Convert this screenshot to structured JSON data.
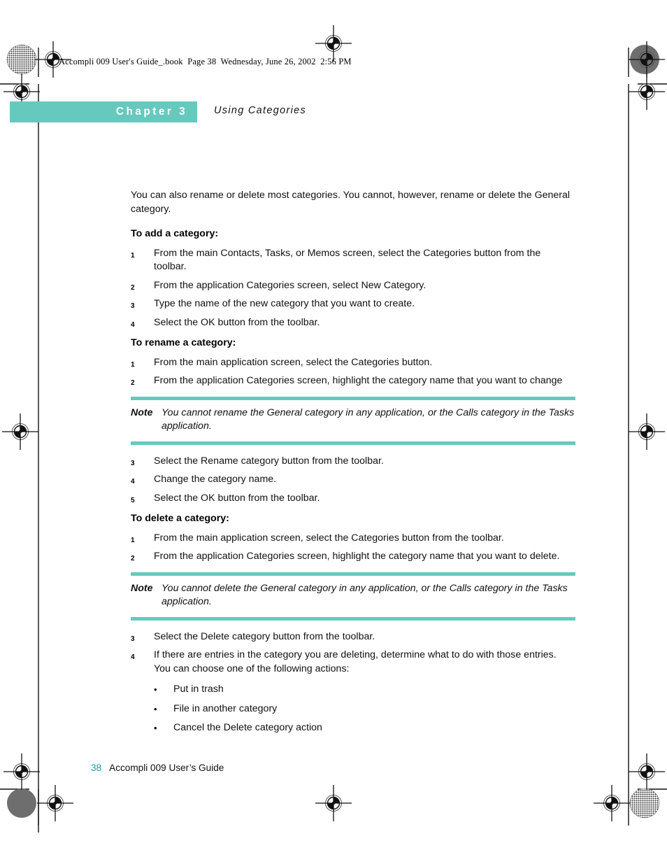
{
  "page": {
    "book_line": "Accompli 009 User's Guide_.book  Page 38  Wednesday, June 26, 2002  2:56 PM",
    "accent_color": "#66c9bd",
    "page_number_color": "#0aa79a"
  },
  "chapter": {
    "banner_label": "Chapter 3",
    "title": "Using Categories"
  },
  "content": {
    "intro_paragraph": "You can also rename or delete most categories. You cannot, however, rename or delete the General category.",
    "sections": [
      {
        "heading": "To add a category:",
        "steps": [
          {
            "num": "1",
            "text": "From the main Contacts, Tasks, or Memos screen, select the Categories button from the toolbar."
          },
          {
            "num": "2",
            "text": "From the application Categories screen, select New Category."
          },
          {
            "num": "3",
            "text": "Type the name of the new category that you want to create."
          },
          {
            "num": "4",
            "text": "Select the OK button from the toolbar."
          }
        ]
      },
      {
        "heading": "To rename a category:",
        "steps": [
          {
            "num": "1",
            "text": "From the main application screen, select the Categories button."
          },
          {
            "num": "2",
            "text": "From the application Categories screen, highlight the category name that you want to change"
          }
        ]
      }
    ],
    "note_rename": {
      "label": "Note",
      "text": "You cannot rename the General category in any application, or the Calls category in the Tasks application."
    },
    "rename_steps_after_note": [
      {
        "num": "3",
        "text": "Select the Rename category button from the toolbar."
      },
      {
        "num": "4",
        "text": "Change the category name."
      },
      {
        "num": "5",
        "text": "Select the OK button from the toolbar."
      }
    ],
    "delete_section": {
      "heading": "To delete a category:",
      "steps": [
        {
          "num": "1",
          "text": "From the main application screen, select the Categories button from the toolbar."
        },
        {
          "num": "2",
          "text": "From the application Categories screen, highlight the category name that you want to delete."
        }
      ]
    },
    "note_delete": {
      "label": "Note",
      "text": "You cannot delete the General category in any application, or the Calls category in the Tasks application."
    },
    "delete_steps_after_note": [
      {
        "num": "3",
        "text": "Select the Delete category button from the toolbar."
      },
      {
        "num": "4",
        "text": "If there are entries in the category you are deleting, determine what to do with those entries. You can choose one of the following actions:"
      }
    ],
    "delete_options": [
      "Put in trash",
      "File in another category",
      "Cancel the Delete category action"
    ],
    "bullet_glyph": "•"
  },
  "footer": {
    "page_number": "38",
    "book_name": "Accompli 009 User’s Guide"
  }
}
